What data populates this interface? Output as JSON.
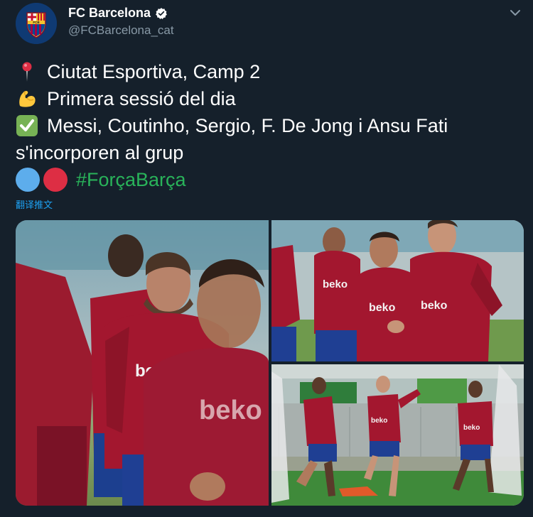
{
  "author": {
    "display_name": "FC Barcelona",
    "handle": "@FCBarcelona_cat",
    "verified": true,
    "avatar_icon": "fc-barcelona-crest",
    "crest_text": "FCB"
  },
  "tweet": {
    "lines": [
      {
        "icon": "round-pushpin-icon",
        "text": "Ciutat Esportiva, Camp 2"
      },
      {
        "icon": "flexed-biceps-icon",
        "text": "Primera sessió del dia"
      },
      {
        "icon": "check-mark-button-icon",
        "text": "Messi, Coutinho, Sergio, F. De Jong i Ansu Fati"
      },
      {
        "icon": "",
        "text": "s'incorporen al grup"
      }
    ],
    "hashtag": "#ForçaBarça",
    "dot_colors": [
      "#5dadec",
      "#dd2e44"
    ]
  },
  "translate_label": "翻译推文",
  "media": {
    "photos": [
      {
        "name": "photo-messi-coutinho",
        "sponsor_text": "beko"
      },
      {
        "name": "photo-coutinho-busquets",
        "sponsor_text": "beko"
      },
      {
        "name": "photo-training-drills",
        "sponsor_text": "beko"
      }
    ]
  },
  "colors": {
    "background": "#15202b",
    "kit_red": "#a3172f",
    "hashtag_green": "#29b35a",
    "link_blue": "#1da1f2"
  }
}
